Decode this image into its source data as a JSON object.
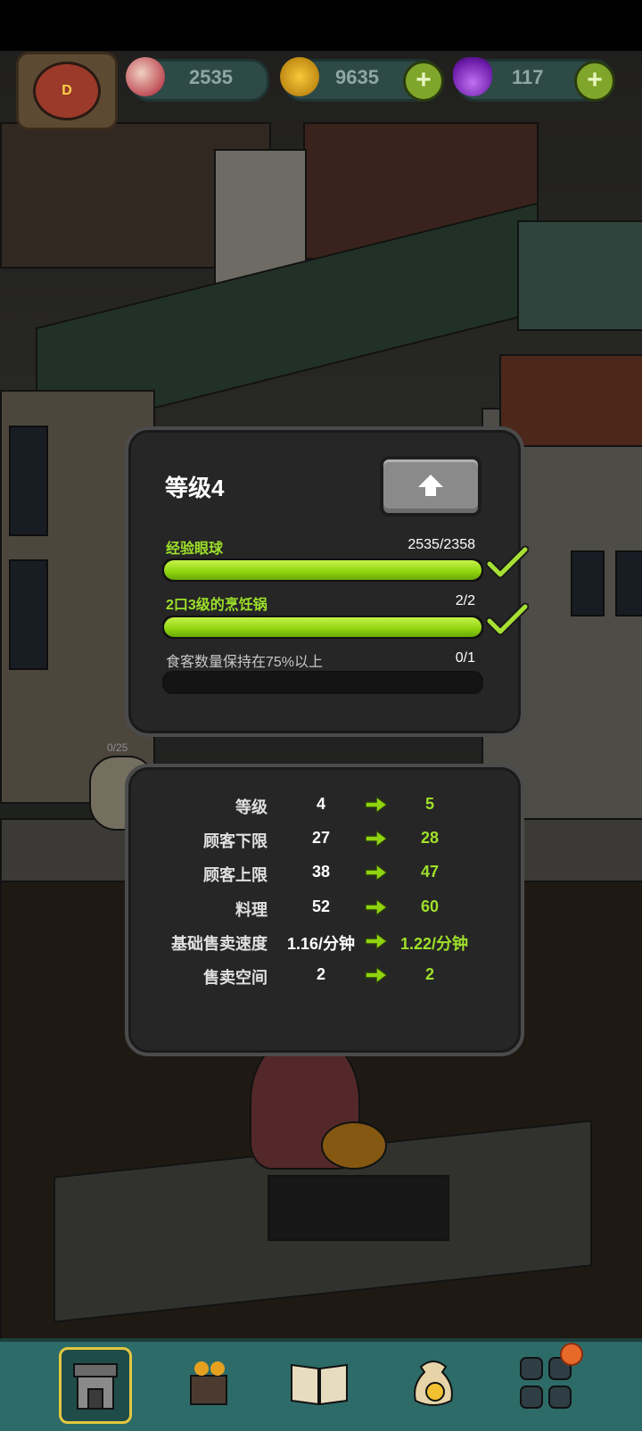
{
  "resources": {
    "eyeballs": "2535",
    "coins": "9635",
    "potions": "117",
    "plus_symbol": "+",
    "avatar_letter": "D"
  },
  "level_panel": {
    "title": "等级4",
    "requirements": [
      {
        "label": "经验眼球",
        "count": "2535/2358",
        "progress": 1.0,
        "done": true
      },
      {
        "label": "2口3级的烹饪锅",
        "count": "2/2",
        "progress": 1.0,
        "done": true
      },
      {
        "label": "食客数量保持在75%以上",
        "count": "0/1",
        "progress": 0.0,
        "done": false
      }
    ]
  },
  "stats_panel": {
    "rows": [
      {
        "name": "等级",
        "current": "4",
        "next": "5"
      },
      {
        "name": "顾客下限",
        "current": "27",
        "next": "28"
      },
      {
        "name": "顾客上限",
        "current": "38",
        "next": "47"
      },
      {
        "name": "料理",
        "current": "52",
        "next": "60"
      },
      {
        "name": "基础售卖速度",
        "current": "1.16/分钟",
        "next": "1.22/分钟"
      },
      {
        "name": "售卖空间",
        "current": "2",
        "next": "2"
      }
    ]
  },
  "scene": {
    "hearts_label": "0/25"
  },
  "colors": {
    "accent_green": "#9ee02a",
    "panel_bg": "#262626",
    "dock_bg": "#2d6b68"
  },
  "dock": {
    "items": [
      "restaurant-icon",
      "kitchen-icon",
      "recipe-book-icon",
      "coin-bag-icon",
      "grid-menu-icon"
    ]
  }
}
